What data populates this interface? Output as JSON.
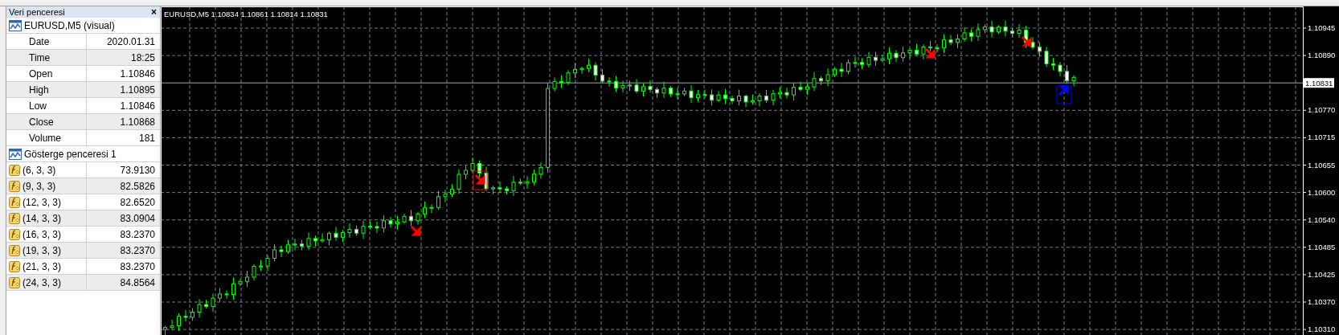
{
  "panel": {
    "title": "Veri penceresi",
    "close": "×",
    "sections": [
      {
        "title": "EURUSD,M5 (visual)",
        "rows": [
          {
            "label": "Date",
            "value": "2020.01.31",
            "kind": "plain"
          },
          {
            "label": "Time",
            "value": "18:25",
            "kind": "plain"
          },
          {
            "label": "Open",
            "value": "1.10846",
            "kind": "plain"
          },
          {
            "label": "High",
            "value": "1.10895",
            "kind": "plain"
          },
          {
            "label": "Low",
            "value": "1.10846",
            "kind": "plain"
          },
          {
            "label": "Close",
            "value": "1.10868",
            "kind": "plain"
          },
          {
            "label": "Volume",
            "value": "181",
            "kind": "plain"
          }
        ]
      },
      {
        "title": "Gösterge penceresi 1",
        "rows": [
          {
            "label": "(6, 3, 3)",
            "value": "73.9130",
            "kind": "indicator"
          },
          {
            "label": "(9, 3, 3)",
            "value": "82.5826",
            "kind": "indicator"
          },
          {
            "label": "(12, 3, 3)",
            "value": "82.6520",
            "kind": "indicator"
          },
          {
            "label": "(14, 3, 3)",
            "value": "83.0904",
            "kind": "indicator"
          },
          {
            "label": "(16, 3, 3)",
            "value": "83.2370",
            "kind": "indicator"
          },
          {
            "label": "(19, 3, 3)",
            "value": "83.2370",
            "kind": "indicator"
          },
          {
            "label": "(21, 3, 3)",
            "value": "83.2370",
            "kind": "indicator"
          },
          {
            "label": "(24, 3, 3)",
            "value": "84.8564",
            "kind": "indicator"
          }
        ]
      }
    ]
  },
  "chart": {
    "header": "EURUSD,M5  1.10834 1.10861 1.10814 1.10831",
    "price_labels": [
      {
        "text": "1.10945",
        "kind": "tick"
      },
      {
        "text": "1.10890",
        "kind": "tick"
      },
      {
        "text": "1.10831",
        "kind": "current"
      },
      {
        "text": "1.10770",
        "kind": "tick"
      },
      {
        "text": "1.10715",
        "kind": "tick"
      },
      {
        "text": "1.10655",
        "kind": "tick"
      },
      {
        "text": "1.10600",
        "kind": "tick"
      },
      {
        "text": "1.10540",
        "kind": "tick"
      },
      {
        "text": "1.10485",
        "kind": "tick"
      },
      {
        "text": "1.10425",
        "kind": "tick"
      },
      {
        "text": "1.10370",
        "kind": "tick"
      },
      {
        "text": "1.10310",
        "kind": "tick"
      }
    ]
  }
}
